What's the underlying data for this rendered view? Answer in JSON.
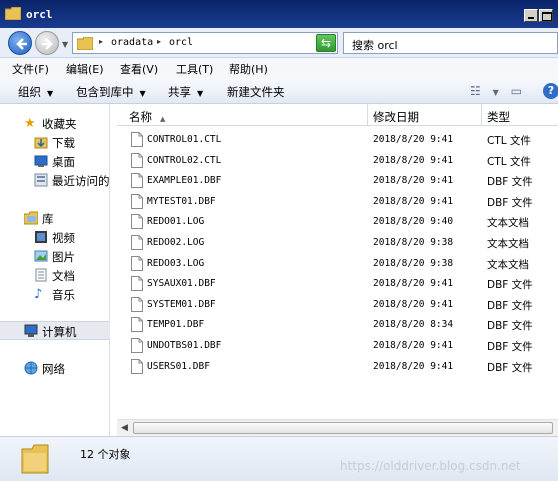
{
  "window": {
    "title": "orcl"
  },
  "nav": {
    "address_parts": [
      "oradata",
      "orcl"
    ],
    "search_placeholder": "搜索 orcl"
  },
  "menu": [
    "文件(F)",
    "编辑(E)",
    "查看(V)",
    "工具(T)",
    "帮助(H)"
  ],
  "toolbar": {
    "organize": "组织",
    "include_in_library": "包含到库中",
    "share": "共享",
    "new_folder": "新建文件夹"
  },
  "sidebar": {
    "favorites": {
      "label": "收藏夹",
      "items": [
        {
          "label": "下载",
          "icon": "download-folder-icon"
        },
        {
          "label": "桌面",
          "icon": "desktop-icon"
        },
        {
          "label": "最近访问的",
          "icon": "recent-places-icon"
        }
      ]
    },
    "libraries": {
      "label": "库",
      "items": [
        {
          "label": "视频",
          "icon": "video-library-icon"
        },
        {
          "label": "图片",
          "icon": "pictures-library-icon"
        },
        {
          "label": "文档",
          "icon": "documents-library-icon"
        },
        {
          "label": "音乐",
          "icon": "music-library-icon"
        }
      ]
    },
    "computer": {
      "label": "计算机"
    },
    "network": {
      "label": "网络"
    }
  },
  "columns": {
    "name": "名称",
    "date": "修改日期",
    "type": "类型"
  },
  "files": [
    {
      "name": "CONTROL01.CTL",
      "date": "2018/8/20 9:41",
      "type": "CTL 文件"
    },
    {
      "name": "CONTROL02.CTL",
      "date": "2018/8/20 9:41",
      "type": "CTL 文件"
    },
    {
      "name": "EXAMPLE01.DBF",
      "date": "2018/8/20 9:41",
      "type": "DBF 文件"
    },
    {
      "name": "MYTEST01.DBF",
      "date": "2018/8/20 9:41",
      "type": "DBF 文件"
    },
    {
      "name": "REDO01.LOG",
      "date": "2018/8/20 9:40",
      "type": "文本文档"
    },
    {
      "name": "REDO02.LOG",
      "date": "2018/8/20 9:38",
      "type": "文本文档"
    },
    {
      "name": "REDO03.LOG",
      "date": "2018/8/20 9:38",
      "type": "文本文档"
    },
    {
      "name": "SYSAUX01.DBF",
      "date": "2018/8/20 9:41",
      "type": "DBF 文件"
    },
    {
      "name": "SYSTEM01.DBF",
      "date": "2018/8/20 9:41",
      "type": "DBF 文件"
    },
    {
      "name": "TEMP01.DBF",
      "date": "2018/8/20 8:34",
      "type": "DBF 文件"
    },
    {
      "name": "UNDOTBS01.DBF",
      "date": "2018/8/20 9:41",
      "type": "DBF 文件"
    },
    {
      "name": "USERS01.DBF",
      "date": "2018/8/20 9:41",
      "type": "DBF 文件"
    }
  ],
  "status": {
    "item_count": "12 个对象"
  },
  "watermark": "https://olddriver.blog.csdn.net",
  "colors": {
    "title_bar": "#0a246a",
    "folder": "#e8c253",
    "accent": "#2d6cc7"
  }
}
